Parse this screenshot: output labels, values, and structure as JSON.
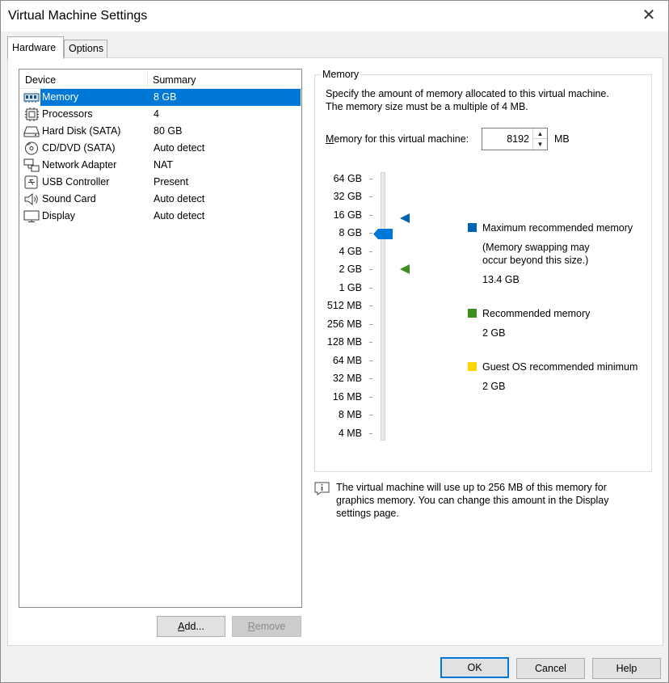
{
  "window": {
    "title": "Virtual Machine Settings"
  },
  "tabs": [
    {
      "label": "Hardware"
    },
    {
      "label": "Options"
    }
  ],
  "device_list": {
    "columns": {
      "device": "Device",
      "summary": "Summary"
    },
    "rows": [
      {
        "name": "Memory",
        "summary": "8 GB",
        "icon": "memory-icon"
      },
      {
        "name": "Processors",
        "summary": "4",
        "icon": "processor-icon"
      },
      {
        "name": "Hard Disk (SATA)",
        "summary": "80 GB",
        "icon": "hard-disk-icon"
      },
      {
        "name": "CD/DVD (SATA)",
        "summary": "Auto detect",
        "icon": "cd-dvd-icon"
      },
      {
        "name": "Network Adapter",
        "summary": "NAT",
        "icon": "network-adapter-icon"
      },
      {
        "name": "USB Controller",
        "summary": "Present",
        "icon": "usb-icon"
      },
      {
        "name": "Sound Card",
        "summary": "Auto detect",
        "icon": "speaker-icon"
      },
      {
        "name": "Display",
        "summary": "Auto detect",
        "icon": "monitor-icon"
      }
    ],
    "selected": "Memory"
  },
  "buttons": {
    "add_pre": "A",
    "add_rest": "dd...",
    "remove_pre": "R",
    "remove_rest": "emove",
    "ok": "OK",
    "cancel": "Cancel",
    "help": "Help"
  },
  "memory": {
    "group_title": "Memory",
    "desc_line1": "Specify the amount of memory allocated to this virtual machine.",
    "desc_line2": "The memory size must be a multiple of 4 MB.",
    "field_label_pre": "M",
    "field_label_rest": "emory for this virtual machine:",
    "value": "8192",
    "unit": "MB",
    "scale": [
      "64 GB",
      "32 GB",
      "16 GB",
      "8 GB",
      "4 GB",
      "2 GB",
      "1 GB",
      "512 MB",
      "256 MB",
      "128 MB",
      "64 MB",
      "32 MB",
      "16 MB",
      "8 MB",
      "4 MB"
    ],
    "slider_value": "8 GB",
    "max_marker_value": "13.4 GB",
    "recommended_marker_value": "2 GB",
    "legend": {
      "max": {
        "label": "Maximum recommended memory",
        "note1": "(Memory swapping may",
        "note2": "occur beyond this size.)",
        "value": "13.4 GB",
        "color": "#0063b1"
      },
      "recommended": {
        "label": "Recommended memory",
        "value": "2 GB",
        "color": "#3d8f1d"
      },
      "guest_min": {
        "label": "Guest OS recommended minimum",
        "value": "2 GB",
        "color": "#ffd700"
      }
    },
    "info": {
      "line1": "The virtual machine will use up to 256 MB of this memory for",
      "line2": "graphics memory. You can change this amount in the Display",
      "line3": "settings page."
    }
  }
}
